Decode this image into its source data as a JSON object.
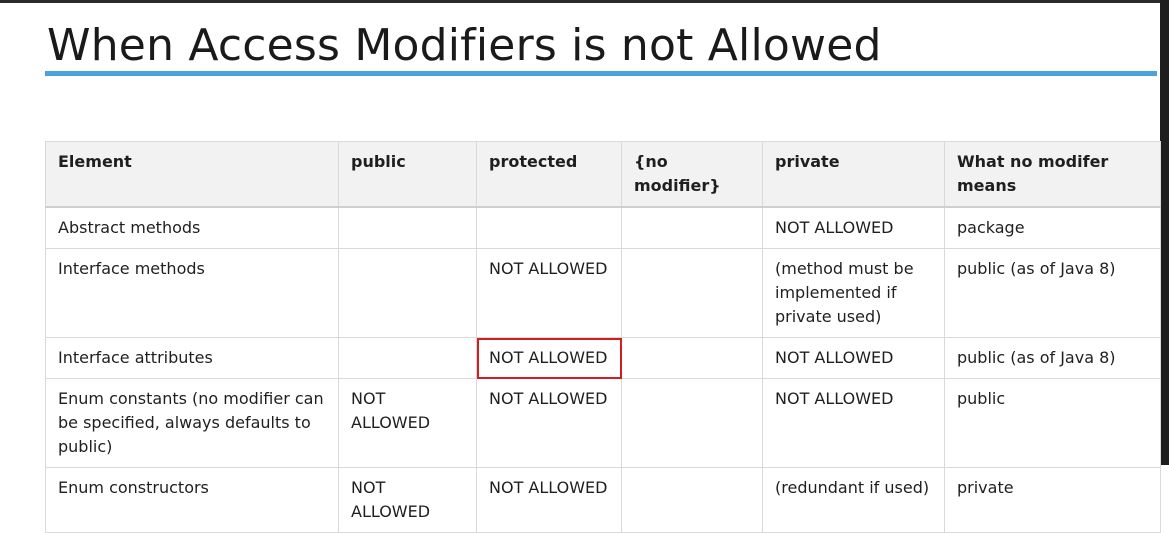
{
  "slide": {
    "title": "When Access Modifiers is not Allowed"
  },
  "table": {
    "headers": [
      "Element",
      "public",
      "protected",
      "{no modifier}",
      "private",
      "What no modifer means"
    ],
    "rows": [
      [
        "Abstract methods",
        "",
        "",
        "",
        "NOT ALLOWED",
        "package"
      ],
      [
        "Interface methods",
        "",
        "NOT ALLOWED",
        "",
        "(method must be implemented if private used)",
        "public (as of Java 8)"
      ],
      [
        "Interface attributes",
        "",
        "NOT ALLOWED",
        "",
        "NOT ALLOWED",
        "public (as of Java 8)"
      ],
      [
        "Enum constants (no modifier can be specified, always defaults to public)",
        "NOT ALLOWED",
        "NOT ALLOWED",
        "",
        "NOT ALLOWED",
        "public"
      ],
      [
        "Enum constructors",
        "NOT ALLOWED",
        "NOT ALLOWED",
        "",
        "(redundant if used)",
        "private"
      ]
    ],
    "highlight_color": "#d61d1d"
  },
  "colors": {
    "accent_rule": "#4aa3df",
    "header_bg": "#f2f2f2"
  }
}
